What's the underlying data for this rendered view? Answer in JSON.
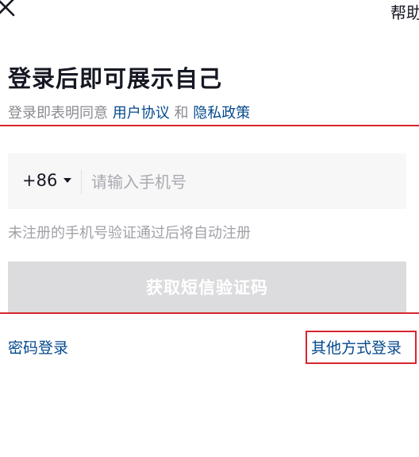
{
  "header": {
    "close_icon": "close-icon",
    "help_label": "帮助"
  },
  "title": "登录后即可展示自己",
  "agreement": {
    "prefix": "登录即表明同意",
    "user_agreement": "用户协议",
    "and": "和",
    "privacy_policy": "隐私政策"
  },
  "phone": {
    "country_code": "+86",
    "placeholder": "请输入手机号",
    "value": ""
  },
  "hint": "未注册的手机号验证通过后将自动注册",
  "sms_button_label": "获取短信验证码",
  "password_login_label": "密码登录",
  "other_login_label": "其他方式登录",
  "colors": {
    "link": "#04498d",
    "annotation": "#d8262f",
    "button_disabled": "#dcdcdf"
  }
}
